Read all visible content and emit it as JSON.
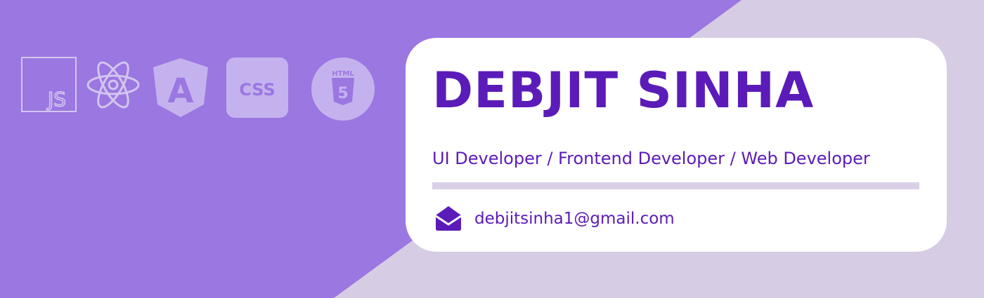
{
  "colors": {
    "primary": "#5b1bb8",
    "background_left": "#9b77e2",
    "background_right": "#d6cde4",
    "card": "#ffffff",
    "divider": "#d9d0e8"
  },
  "tech_icons": [
    "javascript-icon",
    "react-icon",
    "angular-icon",
    "css-icon",
    "html5-icon"
  ],
  "icon_text": {
    "js": "JS",
    "css": "CSS",
    "html": "HTML",
    "html_version": "5",
    "angular": "A"
  },
  "profile": {
    "name": "DEBJIT SINHA",
    "role": "UI Developer / Frontend Developer / Web Developer",
    "email": "debjitsinha1@gmail.com"
  }
}
